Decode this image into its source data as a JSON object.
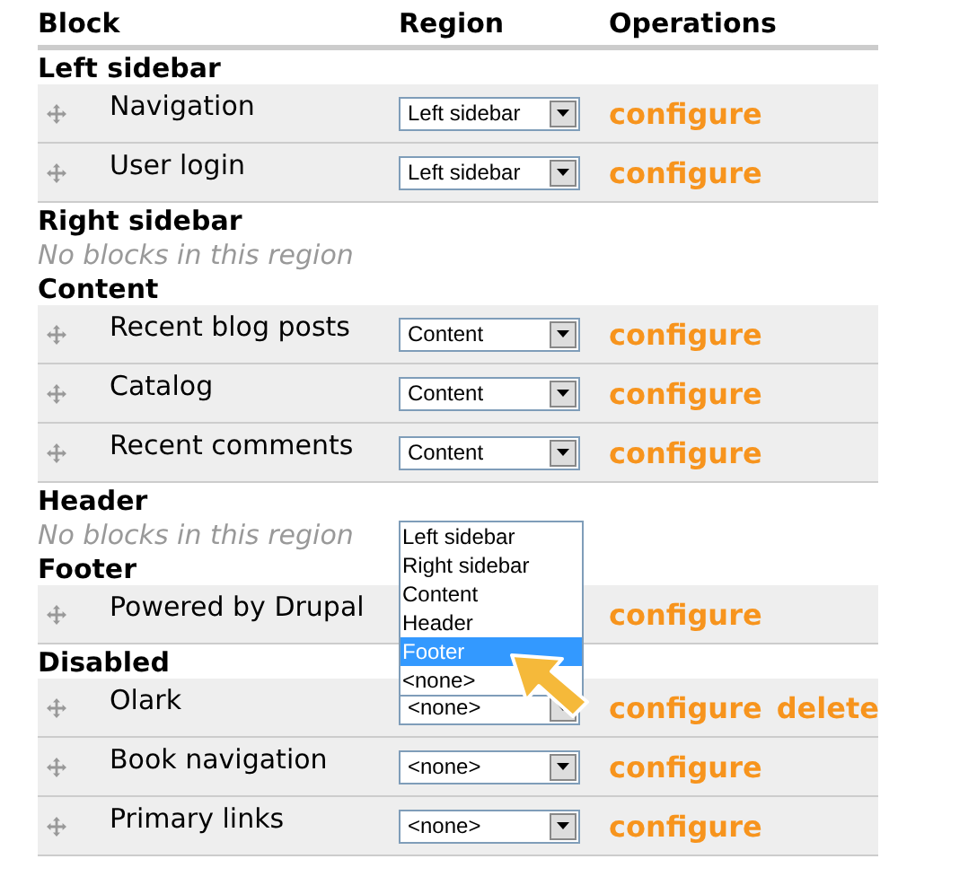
{
  "columns": [
    "Block",
    "Region",
    "Operations"
  ],
  "regions": [
    {
      "title": "Left sidebar",
      "blocks": [
        {
          "name": "Navigation",
          "region": "Left sidebar",
          "operations": [
            "configure"
          ]
        },
        {
          "name": "User login",
          "region": "Left sidebar",
          "operations": [
            "configure"
          ]
        }
      ]
    },
    {
      "title": "Right sidebar",
      "empty_message": "No blocks in this region"
    },
    {
      "title": "Content",
      "blocks": [
        {
          "name": "Recent blog posts",
          "region": "Content",
          "operations": [
            "configure"
          ]
        },
        {
          "name": "Catalog",
          "region": "Content",
          "operations": [
            "configure"
          ]
        },
        {
          "name": "Recent comments",
          "region": "Content",
          "operations": [
            "configure"
          ]
        }
      ]
    },
    {
      "title": "Header",
      "empty_message": "No blocks in this region"
    },
    {
      "title": "Footer",
      "blocks": [
        {
          "name": "Powered by Drupal",
          "operations": [
            "configure"
          ],
          "open_list": [
            {
              "label": "Left sidebar",
              "selected": false
            },
            {
              "label": "Right sidebar",
              "selected": false
            },
            {
              "label": "Content",
              "selected": false
            },
            {
              "label": "Header",
              "selected": false
            },
            {
              "label": "Footer",
              "selected": true
            },
            {
              "label": "<none>",
              "selected": false
            }
          ]
        }
      ]
    },
    {
      "title": "Disabled",
      "blocks": [
        {
          "name": "Olark",
          "region": "<none>",
          "operations": [
            "configure",
            "delete"
          ]
        },
        {
          "name": "Book navigation",
          "region": "<none>",
          "operations": [
            "configure"
          ]
        },
        {
          "name": "Primary links",
          "region": "<none>",
          "operations": [
            "configure"
          ]
        }
      ]
    }
  ]
}
